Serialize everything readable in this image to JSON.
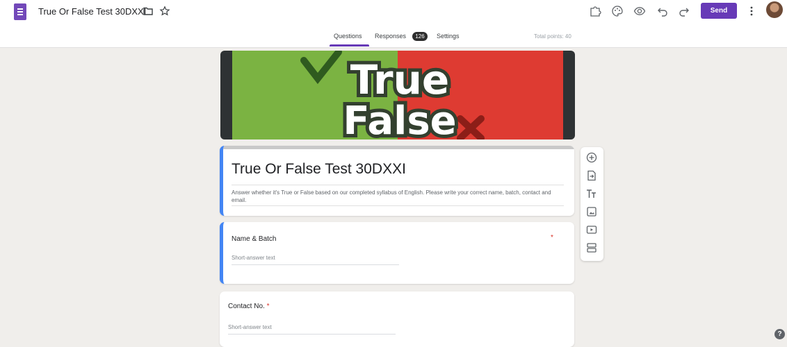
{
  "header": {
    "doc_title": "True Or False Test 30DXXI",
    "send_label": "Send",
    "tabs": [
      {
        "label": "Questions",
        "active": true
      },
      {
        "label": "Responses",
        "badge": "126"
      },
      {
        "label": "Settings"
      }
    ],
    "total_points": "Total points: 40",
    "icons": [
      "folder-icon",
      "star-icon",
      "addon-icon",
      "palette-icon",
      "preview-icon",
      "undo-icon",
      "redo-icon",
      "more-vert-icon"
    ]
  },
  "banner": {
    "line1": "True",
    "line2": "False",
    "colors": {
      "left": "#7bb342",
      "right": "#de3b32",
      "frame": "#2e3234"
    }
  },
  "form": {
    "title": "True Or False Test 30DXXI",
    "description": "Answer whether it's True or False based on our completed syllabus of English. Please write your correct name, batch, contact and email."
  },
  "questions": [
    {
      "label": "Name & Batch",
      "required_mark": "*",
      "hint": "Short-answer text"
    },
    {
      "label": "Contact No.",
      "required_mark": "*",
      "hint": "Short-answer text"
    }
  ],
  "side_toolbar": [
    "add-question-icon",
    "import-questions-icon",
    "add-title-icon",
    "add-image-icon",
    "add-video-icon",
    "add-section-icon"
  ],
  "help": {
    "label": "?"
  },
  "colors": {
    "accent": "#673ab7",
    "active_border": "#4285f4",
    "background": "#f0eeeb"
  }
}
